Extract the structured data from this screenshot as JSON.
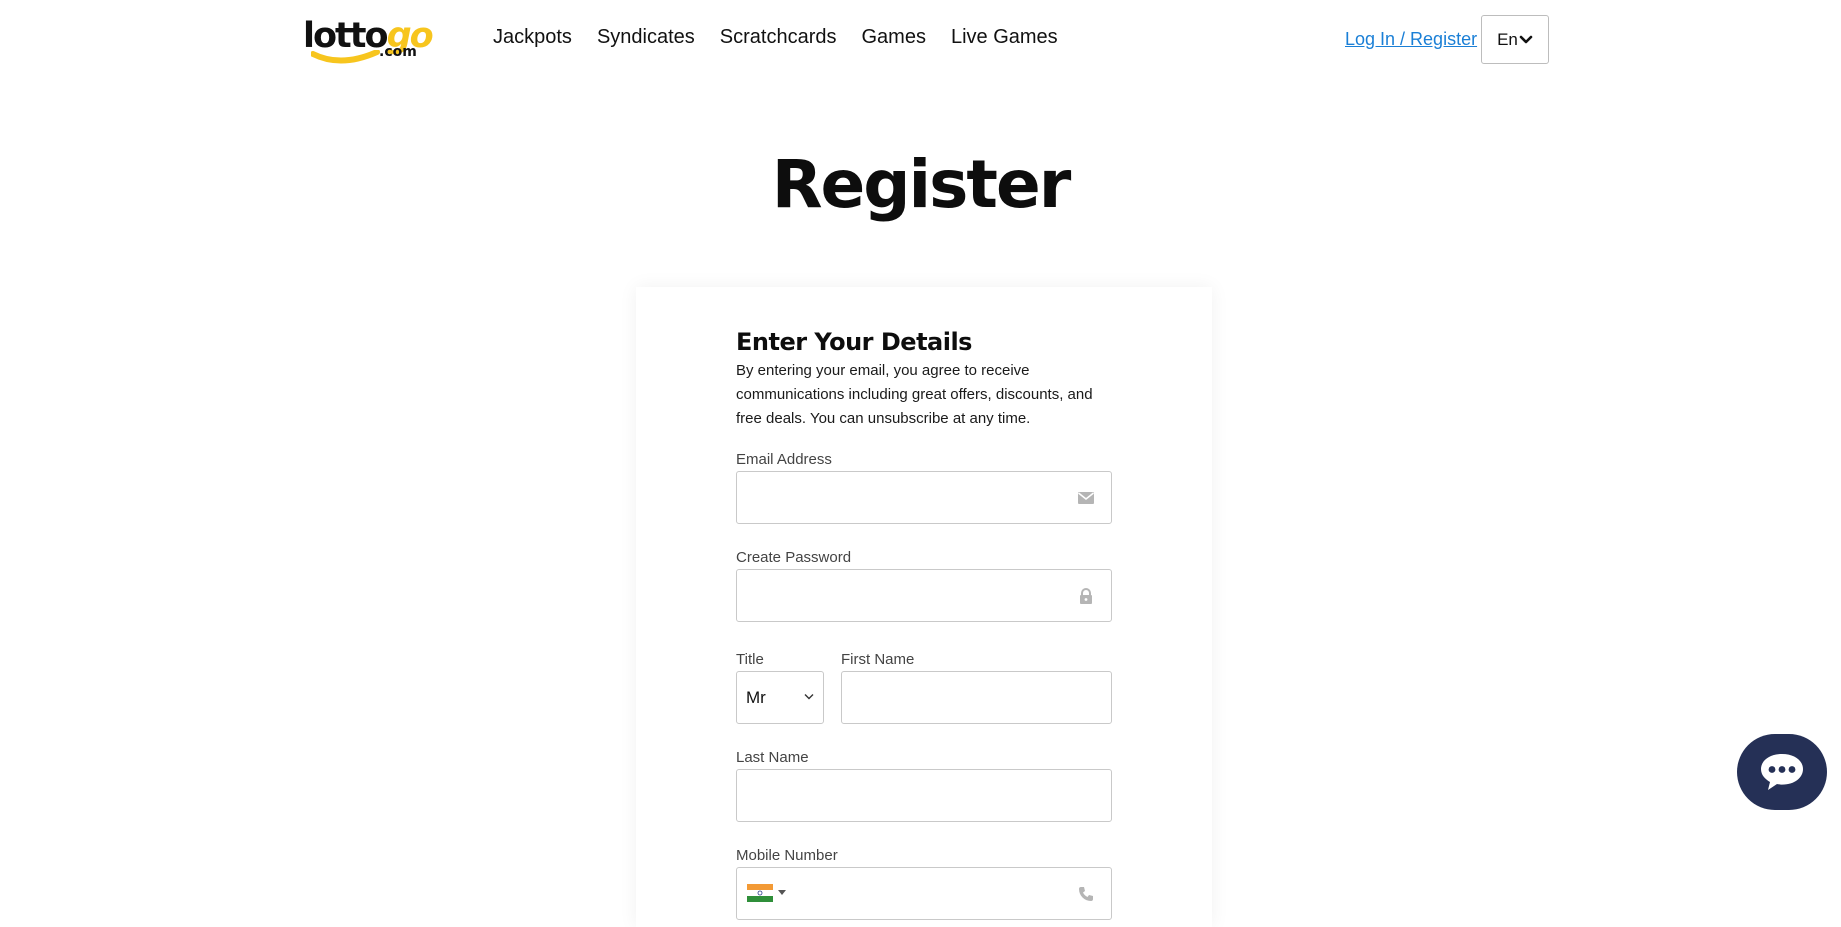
{
  "header": {
    "logo": {
      "main": "lotto",
      "accent": "go",
      "suffix": ".com"
    },
    "nav": [
      {
        "label": "Jackpots"
      },
      {
        "label": "Syndicates"
      },
      {
        "label": "Scratchcards"
      },
      {
        "label": "Games"
      },
      {
        "label": "Live Games"
      }
    ],
    "login_label": "Log In / Register",
    "language": "En"
  },
  "page": {
    "title": "Register"
  },
  "form": {
    "section_title": "Enter Your Details",
    "section_desc": "By entering your email, you agree to receive communications including great offers, discounts, and free deals. You can unsubscribe at any time.",
    "email": {
      "label": "Email Address",
      "value": "",
      "icon": "envelope-icon"
    },
    "password": {
      "label": "Create Password",
      "value": "",
      "icon": "lock-icon"
    },
    "title_field": {
      "label": "Title",
      "selected": "Mr"
    },
    "first_name": {
      "label": "First Name",
      "value": ""
    },
    "last_name": {
      "label": "Last Name",
      "value": ""
    },
    "mobile": {
      "label": "Mobile Number",
      "value": "",
      "country_flag": "india-flag-icon",
      "icon": "phone-icon"
    }
  },
  "chat": {
    "icon": "chat-bubble-icon"
  },
  "colors": {
    "accent_yellow": "#f7c51e",
    "link_blue": "#1a7fd6",
    "chat_navy": "#253056"
  }
}
